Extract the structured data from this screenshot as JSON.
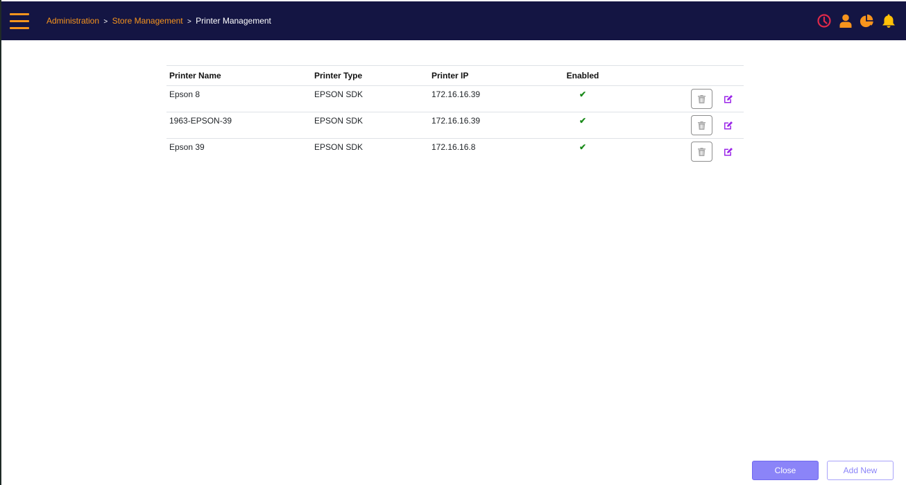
{
  "header": {
    "menu_icon": "hamburger-menu-icon",
    "breadcrumb": [
      {
        "label": "Administration",
        "link": true
      },
      {
        "label": "Store Management",
        "link": true
      },
      {
        "label": "Printer Management",
        "link": false
      }
    ],
    "separator": ">",
    "icons": [
      {
        "name": "clock-icon",
        "color": "#e0294a"
      },
      {
        "name": "user-icon",
        "color": "#f7941d"
      },
      {
        "name": "pie-chart-icon",
        "color": "#f7941d"
      },
      {
        "name": "bell-icon",
        "color": "#ffc107"
      }
    ]
  },
  "table": {
    "columns": [
      "Printer Name",
      "Printer Type",
      "Printer IP",
      "Enabled",
      ""
    ],
    "rows": [
      {
        "name": "Epson 8",
        "type": "EPSON SDK",
        "ip": "172.16.16.39",
        "enabled": "✔"
      },
      {
        "name": "1963-EPSON-39",
        "type": "EPSON SDK",
        "ip": "172.16.16.39",
        "enabled": "✔"
      },
      {
        "name": "Epson 39",
        "type": "EPSON SDK",
        "ip": "172.16.16.8",
        "enabled": "✔"
      }
    ]
  },
  "footer": {
    "close_label": "Close",
    "add_new_label": "Add New"
  },
  "colors": {
    "header_bg": "#141543",
    "accent_orange": "#f7941d",
    "primary_purple": "#8b84f8",
    "edit_icon": "#9b27e8",
    "check_green": "#1a8a1a"
  }
}
